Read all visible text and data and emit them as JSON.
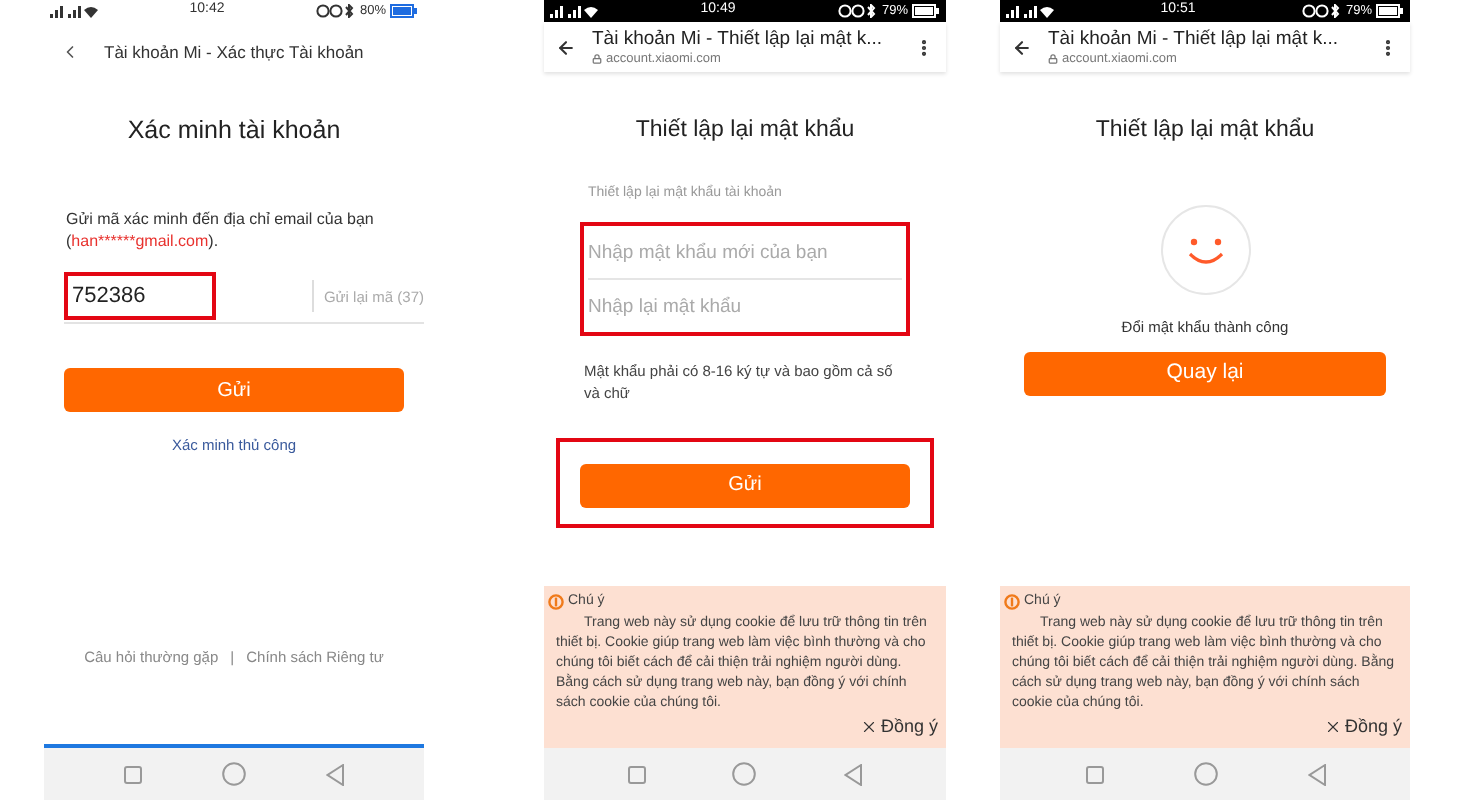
{
  "screens": [
    {
      "kind": "verify",
      "status_bar": {
        "dark": false,
        "time": "10:42",
        "battery": "80%"
      },
      "header": {
        "title": "Tài khoản Mi - Xác thực Tài khoản"
      },
      "heading": "Xác minh tài khoản",
      "intro": "Gửi mã xác minh đến địa chỉ email của bạn",
      "email_open": "(",
      "email": "han******gmail.com",
      "email_close": ").",
      "code_field": {
        "value": "752386",
        "highlighted": true
      },
      "resend": "Gửi lại mã (37)",
      "submit": {
        "label": "Gửi",
        "highlighted": false
      },
      "manual_link": "Xác minh thủ công",
      "footer_links": [
        "Câu hỏi thường gặp",
        "Chính sách Riêng tư"
      ],
      "separator": "|",
      "loading_bar": {
        "level": 1
      }
    },
    {
      "kind": "reset",
      "status_bar": {
        "dark": true,
        "time": "10:49",
        "battery": "79%"
      },
      "header": {
        "title": "Tài khoản Mi - Thiết lập lại mật k...",
        "url": "account.xiaomi.com"
      },
      "heading": "Thiết lập lại mật khẩu",
      "subtitle": "Thiết lập lại mật khẩu tài khoản",
      "fields_highlighted": true,
      "fields": [
        {
          "placeholder": "Nhập mật khẩu mới của bạn"
        },
        {
          "placeholder": "Nhập lại mật khẩu"
        }
      ],
      "note": "Mật khẩu phải có 8-16 ký tự và bao gồm cả số và chữ",
      "submit": {
        "label": "Gửi",
        "highlighted": true
      },
      "cookie": {
        "title": "Chú ý",
        "text": "Trang web này sử dụng cookie để lưu trữ thông tin trên thiết bị. Cookie giúp trang web làm việc bình thường và cho chúng tôi biết cách để cải thiện trải nghiệm người dùng. Bằng cách sử dụng trang web này, bạn đồng ý với chính sách cookie của chúng tôi.",
        "accept": "Đồng ý"
      }
    },
    {
      "kind": "done",
      "status_bar": {
        "dark": true,
        "time": "10:51",
        "battery": "79%"
      },
      "header": {
        "title": "Tài khoản Mi - Thiết lập lại mật k...",
        "url": "account.xiaomi.com"
      },
      "heading": "Thiết lập lại mật khẩu",
      "message": "Đổi mật khẩu thành công",
      "back_button": {
        "label": "Quay lại"
      },
      "cookie": {
        "title": "Chú ý",
        "text": "Trang web này sử dụng cookie để lưu trữ thông tin trên thiết bị. Cookie giúp trang web làm việc bình thường và cho chúng tôi biết cách để cải thiện trải nghiệm người dùng. Bằng cách sử dụng trang web này, bạn đồng ý với chính sách cookie của chúng tôi.",
        "accept": "Đồng ý"
      }
    }
  ]
}
